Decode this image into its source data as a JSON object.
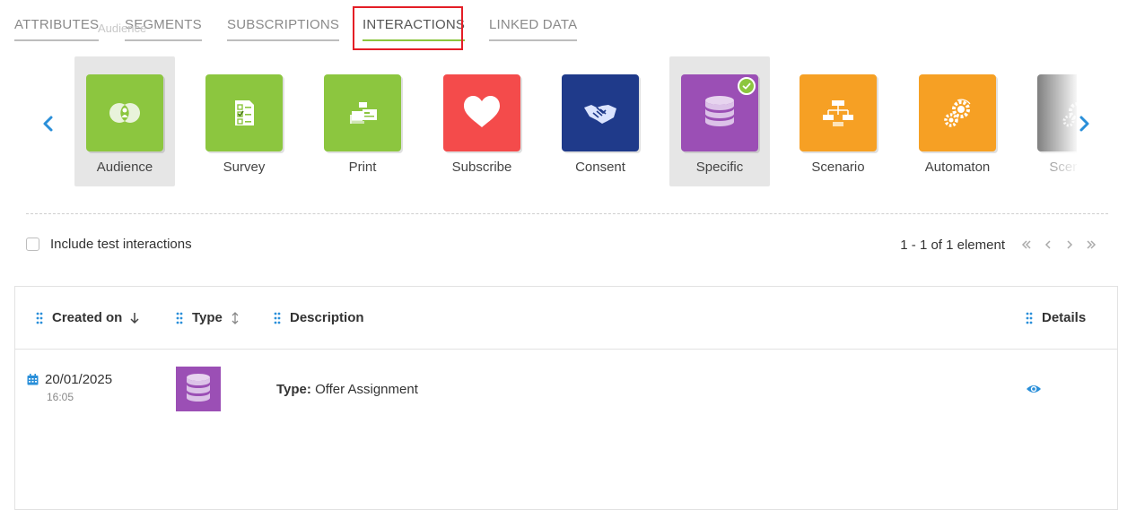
{
  "tabs": [
    {
      "label": "ATTRIBUTES",
      "active": false
    },
    {
      "label": "SEGMENTS",
      "active": false
    },
    {
      "label": "SUBSCRIPTIONS",
      "active": false
    },
    {
      "label": "INTERACTIONS",
      "active": true
    },
    {
      "label": "LINKED DATA",
      "active": false
    }
  ],
  "ghost_label": "Audience",
  "carousel": {
    "items": [
      {
        "label": "Audience",
        "color": "#8cc63f",
        "icon": "venn-user-icon",
        "selected": true
      },
      {
        "label": "Survey",
        "color": "#8cc63f",
        "icon": "survey-checklist-icon",
        "selected": false
      },
      {
        "label": "Print",
        "color": "#8cc63f",
        "icon": "print-documents-icon",
        "selected": false
      },
      {
        "label": "Subscribe",
        "color": "#f44b4b",
        "icon": "heart-icon",
        "selected": false
      },
      {
        "label": "Consent",
        "color": "#1f3a8a",
        "icon": "handshake-icon",
        "selected": false
      },
      {
        "label": "Specific",
        "color": "#9b4fb5",
        "icon": "database-icon",
        "selected": true,
        "checked": true
      },
      {
        "label": "Scenario",
        "color": "#f6a024",
        "icon": "scenario-flow-icon",
        "selected": false
      },
      {
        "label": "Automaton",
        "color": "#f6a024",
        "icon": "automaton-gears-icon",
        "selected": false
      },
      {
        "label": "Scenario",
        "color": "#555555",
        "icon": "gears-icon",
        "selected": false
      }
    ]
  },
  "filters": {
    "include_test_label": "Include test interactions"
  },
  "pagination": {
    "summary": "1 - 1 of 1 element"
  },
  "table": {
    "columns": {
      "created_on": "Created on",
      "type": "Type",
      "description": "Description",
      "details": "Details"
    },
    "rows": [
      {
        "date": "20/01/2025",
        "time": "16:05",
        "type_icon": "database-icon",
        "type_color": "#9b4fb5",
        "desc_key": "Type:",
        "desc_value": "Offer Assignment"
      }
    ]
  },
  "colors": {
    "accent_blue": "#2a8fd9",
    "active_tab_underline": "#8cc63f",
    "highlight_red": "#e41e26"
  }
}
